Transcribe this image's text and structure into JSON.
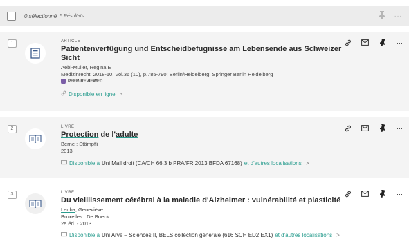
{
  "toolbar": {
    "selected_label": "0 sélectionné",
    "results_label": "5 Résultats"
  },
  "results": [
    {
      "number": "1",
      "type": "ARTICLE",
      "title": "Patientenverfügung und Entscheidbefugnisse am Lebensende aus Schweizer Sicht",
      "author": "Aebi-Müller, Regina E",
      "source": "Medizinrecht, 2018-10, Vol.36 (10), p.785-790; Berlin/Heidelberg: Springer Berlin Heidelberg",
      "peer_reviewed": "PEER-REVIEWED",
      "availability": "Disponible en ligne",
      "availability_chevron": ">"
    },
    {
      "number": "2",
      "type": "LIVRE",
      "title_part1": "Protection",
      "title_part2": " de l'",
      "title_part3": "adulte",
      "publisher": "Berne : Stämpfli",
      "year": "2013",
      "avail_prefix": "Disponible à",
      "avail_middle": " Uni Mail  droit (CA/CH 66.3 b PRA/FR 2013 BFDA 67168) ",
      "avail_suffix": "et d'autres localisations",
      "availability_chevron": ">"
    },
    {
      "number": "3",
      "type": "LIVRE",
      "title": "Du vieillissement cérébral à la maladie d'Alzheimer : vulnérabilité et plasticité",
      "author_underlined": "Leuba",
      "author_rest": ", Geneviève",
      "publisher": "Bruxelles : De Boeck",
      "edition": "2e éd. - 2013",
      "avail_prefix": "Disponible à",
      "avail_middle": " Uni Arve – Sciences II, BELS  collection générale (616 SCH ED2 EX1) ",
      "avail_suffix": "et d'autres localisations",
      "availability_chevron": ">"
    }
  ],
  "colors": {
    "accent": "#2a9d8f",
    "peer_reviewed": "#7b5ea7"
  }
}
